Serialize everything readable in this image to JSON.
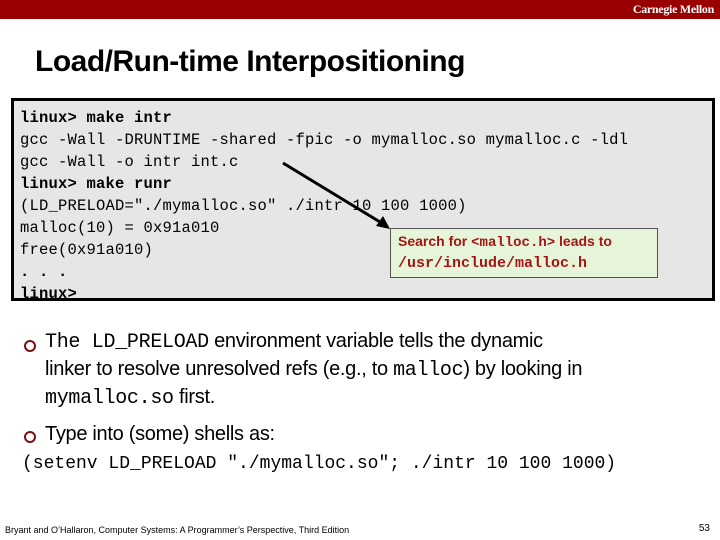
{
  "header": {
    "brand": "Carnegie Mellon",
    "bar_color": "#990000"
  },
  "slide": {
    "title": "Load/Run-time Interpositioning"
  },
  "terminal": {
    "lines": [
      {
        "text": "linux> make intr",
        "bold": true
      },
      {
        "text": "gcc -Wall -DRUNTIME -shared -fpic -o mymalloc.so mymalloc.c -ldl",
        "bold": false
      },
      {
        "text": "gcc -Wall -o intr int.c",
        "bold": false
      },
      {
        "text": "linux> make runr",
        "bold": true
      },
      {
        "text": "(LD_PRELOAD=\"./mymalloc.so\" ./intr 10 100 1000)",
        "bold": false
      },
      {
        "text": "malloc(10) = 0x91a010",
        "bold": false
      },
      {
        "text": "free(0x91a010)",
        "bold": false
      },
      {
        "text": ". . .",
        "bold": true
      },
      {
        "text": "linux>",
        "bold": true
      }
    ]
  },
  "callout": {
    "prefix": "Search for ",
    "code": "<malloc.h>",
    "suffix": " leads to",
    "path": "/usr/include/malloc.h",
    "text_color": "#a31515",
    "bg_color": "#e6f5d9"
  },
  "bullets": [
    {
      "line1_code": "The LD_PRELOAD",
      "line1_text": " environment variable tells the dynamic",
      "line2_text_a": "linker to resolve unresolved refs (e.g., to ",
      "line2_code": "malloc",
      "line2_text_b": ") by looking in",
      "line3_code": "mymalloc.so",
      "line3_text": " first."
    },
    {
      "text": "Type into (some) shells as:"
    }
  ],
  "command": "(setenv LD_PRELOAD \"./mymalloc.so\"; ./intr 10 100 1000)",
  "footer": {
    "citation": "Bryant and O’Hallaron, Computer Systems: A Programmer’s Perspective, Third Edition",
    "page_number": "53"
  }
}
